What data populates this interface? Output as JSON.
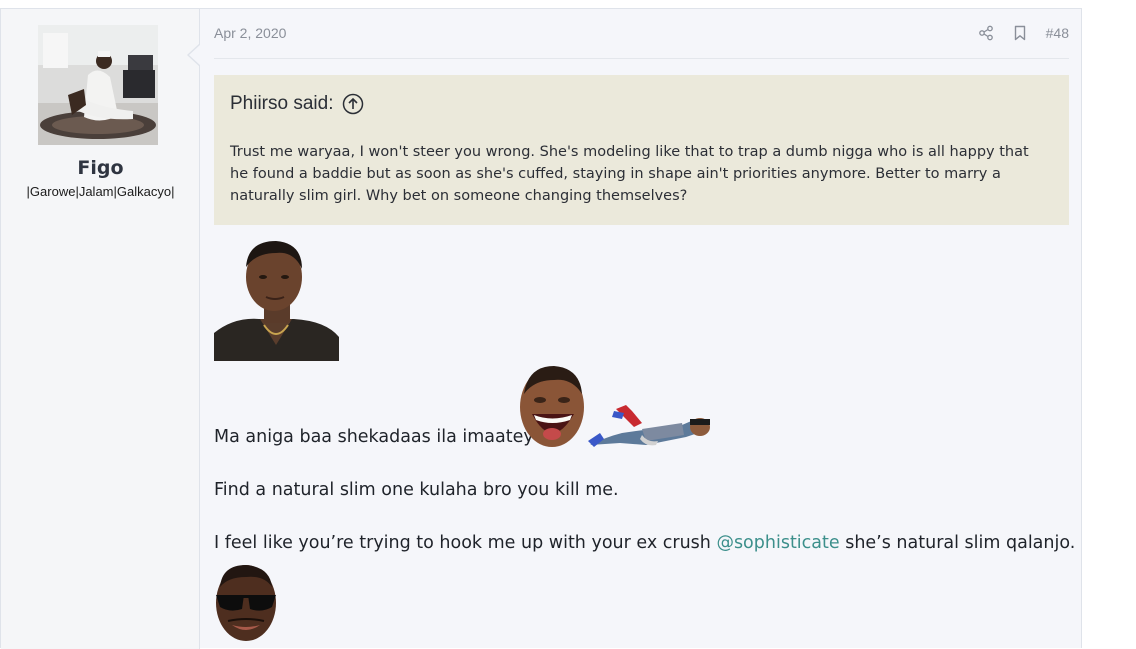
{
  "user": {
    "name": "Figo",
    "title": "|Garowe|Jalam|Galkacyo|"
  },
  "post": {
    "date": "Apr 2, 2020",
    "number": "#48",
    "actions": {
      "share_icon": "share-icon",
      "bookmark_icon": "bookmark-icon"
    }
  },
  "quote": {
    "author_label": "Phiirso said:",
    "expand_icon": "arrow-up-circle-icon",
    "text": "Trust me waryaa, I won't steer you wrong. She's modeling like that to trap a dumb nigga who is all happy that he found a baddie but as soon as she's cuffed, staying in shape ain't priorities anymore. Better to marry a naturally slim girl. Why bet on someone changing themselves?"
  },
  "body": {
    "line1": "Ma aniga baa shekadaas ila imaatey?",
    "line2": "Find a natural slim one kulaha bro you kill me.",
    "line3_before": "I feel like you’re trying to hook me up with your ex crush ",
    "line3_mention": "@sophisticate",
    "line3_after": " she’s natural slim qalanjo."
  },
  "colors": {
    "quote_bg": "#ebe9db",
    "mention": "#3c8f8b",
    "post_bg": "#f5f6fa"
  }
}
